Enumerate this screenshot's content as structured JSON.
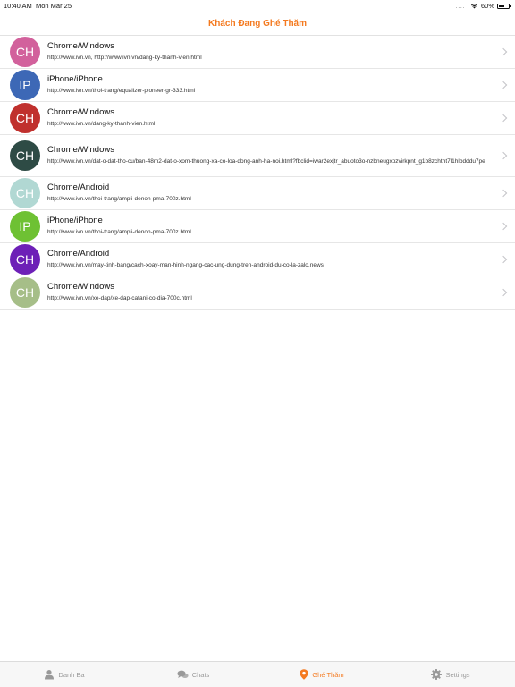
{
  "status_bar": {
    "time": "10:40 AM",
    "date": "Mon Mar 25",
    "signal_dots": "....",
    "battery_text": "60%",
    "battery_level": 0.6
  },
  "nav": {
    "title": "Khách Đang Ghé Thăm",
    "title_color": "#f47a20"
  },
  "visitors": [
    {
      "initials": "CH",
      "color": "#d2619c",
      "title": "Chrome/Windows",
      "url": "http://www.ivn.vn, http://www.ivn.vn/dang-ky-thanh-vien.html"
    },
    {
      "initials": "IP",
      "color": "#3d68b6",
      "title": "iPhone/iPhone",
      "url": "http://www.ivn.vn/thoi-trang/equalizer-pioneer-gr-333.html"
    },
    {
      "initials": "CH",
      "color": "#c0302d",
      "title": "Chrome/Windows",
      "url": "http://www.ivn.vn/dang-ky-thanh-vien.html"
    },
    {
      "initials": "CH",
      "color": "#2e4b45",
      "title": "Chrome/Windows",
      "url": "http://www.ivn.vn/dat-o-dat-tho-cu/ban-48m2-dat-o-xom-thuong-xa-co-loa-dong-anh-ha-noi.html?fbclid=iwar2exjtr_abuoto3o-nzbneugxozvirkpnt_g1b8zchtht7l1hlbdddu7pe"
    },
    {
      "initials": "CH",
      "color": "#b1d8d3",
      "title": "Chrome/Android",
      "url": "http://www.ivn.vn/thoi-trang/ampli-denon-pma-700z.html"
    },
    {
      "initials": "IP",
      "color": "#6ec133",
      "title": "iPhone/iPhone",
      "url": "http://www.ivn.vn/thoi-trang/ampli-denon-pma-700z.html"
    },
    {
      "initials": "CH",
      "color": "#6d20b7",
      "title": "Chrome/Android",
      "url": "http://www.ivn.vn/may-tinh-bang/cach-xoay-man-hinh-ngang-cac-ung-dung-tren-android-du-co-la-zalo.news"
    },
    {
      "initials": "CH",
      "color": "#a6be88",
      "title": "Chrome/Windows",
      "url": "http://www.ivn.vn/xe-dap/xe-dap-catani-co-dia-700c.html"
    }
  ],
  "tabs": [
    {
      "label": "Danh Ba",
      "icon": "contacts-icon",
      "active": false
    },
    {
      "label": "Chats",
      "icon": "chat-bubbles-icon",
      "active": false
    },
    {
      "label": "Ghé Thăm",
      "icon": "location-pin-icon",
      "active": true
    },
    {
      "label": "Settings",
      "icon": "gear-icon",
      "active": false
    }
  ]
}
